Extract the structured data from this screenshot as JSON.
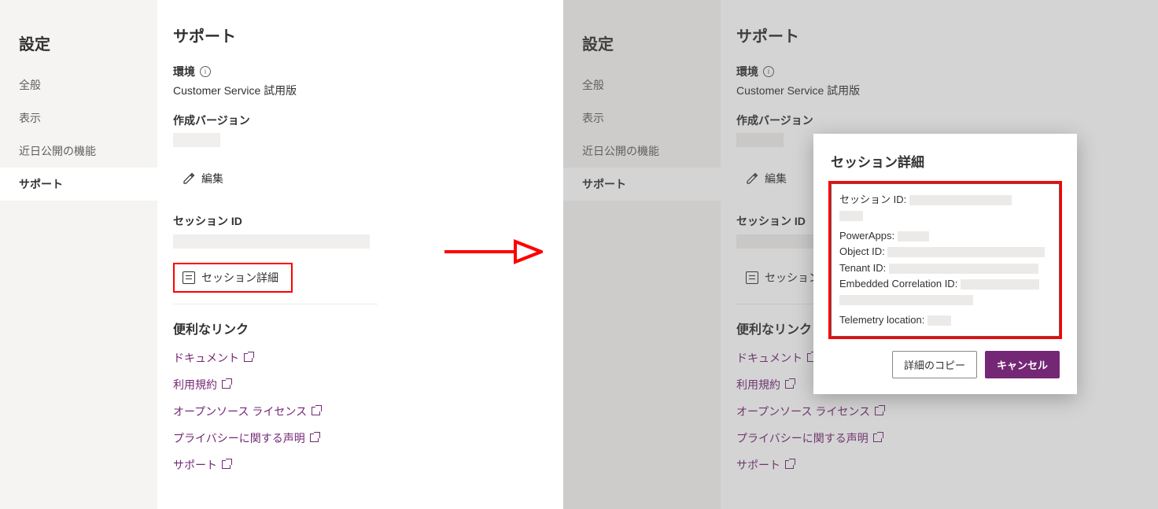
{
  "sidebar": {
    "title": "設定",
    "items": [
      "全般",
      "表示",
      "近日公開の機能",
      "サポート"
    ],
    "activeIndex": 3
  },
  "content": {
    "title": "サポート",
    "envLabel": "環境",
    "envValue": "Customer Service 試用版",
    "versionLabel": "作成バージョン",
    "editLabel": "編集",
    "sessionIdLabel": "セッション ID",
    "sessionDetailsBtn": "セッション詳細",
    "usefulLinksTitle": "便利なリンク",
    "links": [
      "ドキュメント",
      "利用規約",
      "オープンソース ライセンス",
      "プライバシーに関する声明",
      "サポート"
    ]
  },
  "dialog": {
    "title": "セッション詳細",
    "fields": [
      "セッション ID:",
      "PowerApps:",
      "Object ID:",
      "Tenant ID:",
      "Embedded Correlation ID:",
      "Telemetry location:"
    ],
    "copyLabel": "詳細のコピー",
    "cancelLabel": "キャンセル"
  }
}
